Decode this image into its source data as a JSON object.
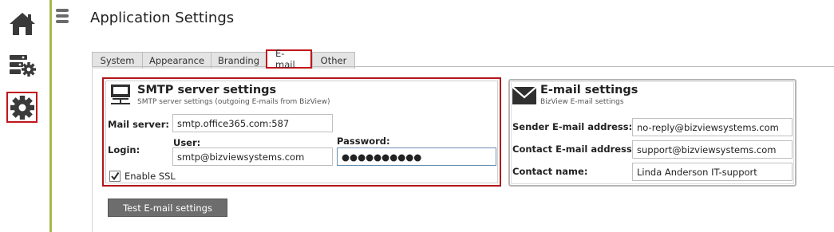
{
  "page": {
    "title": "Application Settings"
  },
  "rail": {
    "items": [
      {
        "icon": "home-icon"
      },
      {
        "icon": "data-settings-icon"
      },
      {
        "icon": "gear-icon",
        "selected": true
      }
    ]
  },
  "tabs": [
    {
      "label": "System"
    },
    {
      "label": "Appearance"
    },
    {
      "label": "Branding"
    },
    {
      "label": "E-mail",
      "active": true
    },
    {
      "label": "Other"
    }
  ],
  "smtp": {
    "title": "SMTP server settings",
    "subtitle": "SMTP server settings (outgoing E-mails from BizView)",
    "mail_server_label": "Mail server:",
    "mail_server_value": "smtp.office365.com:587",
    "login_label": "Login:",
    "user_label": "User:",
    "user_value": "smtp@bizviewsystems.com",
    "password_label": "Password:",
    "password_value": "●●●●●●●●●●",
    "ssl_label": "Enable SSL",
    "ssl_checked": true
  },
  "email": {
    "title": "E-mail settings",
    "subtitle": "BizView E-mail settings",
    "sender_label": "Sender E-mail address:",
    "sender_value": "no-reply@bizviewsystems.com",
    "contact_email_label": "Contact E-mail address:",
    "contact_email_value": "support@bizviewsystems.com",
    "contact_name_label": "Contact name:",
    "contact_name_value": "Linda Anderson IT-support"
  },
  "actions": {
    "test_label": "Test E-mail settings"
  },
  "colors": {
    "highlight_border": "#c0161b",
    "rail_divider": "#a8b84a",
    "button_bg": "#6d6d6d"
  }
}
